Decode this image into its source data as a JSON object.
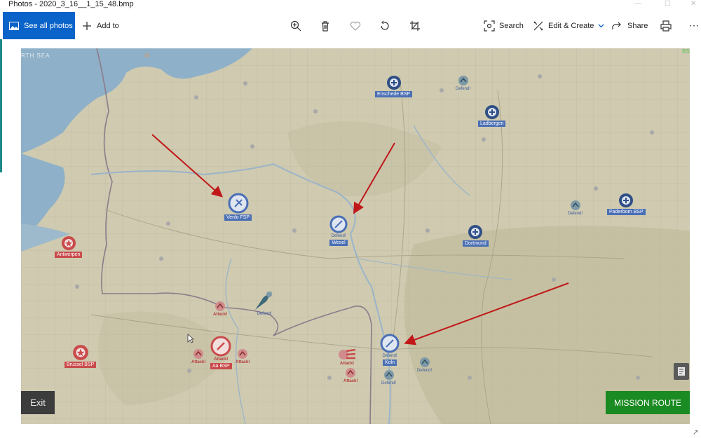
{
  "window": {
    "title": "Photos - 2020_3_16__1_15_48.bmp"
  },
  "toolbar": {
    "see_all_photos": "See all photos",
    "add_to": "Add to",
    "search": "Search",
    "edit_create": "Edit & Create",
    "share": "Share"
  },
  "map": {
    "sea_label": "RTH SEA",
    "corner_tag": "BS",
    "blue_markers": [
      {
        "name": "Enschede BSP",
        "type": "base"
      },
      {
        "name": "Ladbergen",
        "type": "base"
      },
      {
        "name": "Paderborn BSP",
        "type": "base"
      },
      {
        "name": "Dortmund",
        "type": "base"
      },
      {
        "name": "Venlo FSP",
        "type": "selected"
      },
      {
        "name": "Wesel",
        "type": "selected",
        "sub": "Defend!"
      },
      {
        "name": "Koln",
        "type": "selected",
        "sub": "Defend!"
      }
    ],
    "red_markers": [
      {
        "name": "Antwerpen",
        "type": "base"
      },
      {
        "name": "Brussel BSP",
        "type": "base"
      },
      {
        "name": "Aa BSP",
        "type": "selected",
        "sub": "Attack!"
      }
    ],
    "orders": {
      "defend": "Defend!",
      "attack": "Attack!"
    }
  },
  "buttons": {
    "exit": "Exit",
    "mission_route": "MISSION ROUTE"
  },
  "colors": {
    "accent": "#0a63c9",
    "mission_route": "#1a8a22",
    "blue_faction": "#4a6fb5",
    "red_faction": "#c94b4b",
    "arrow": "#c01818"
  }
}
